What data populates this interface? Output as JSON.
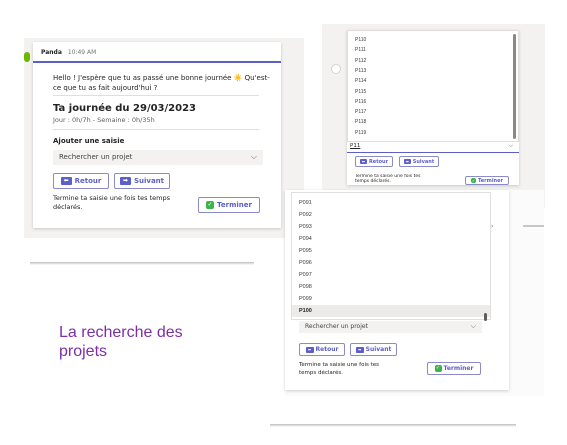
{
  "main": {
    "sender": "Panda",
    "time": "10:49 AM",
    "greeting": "Hello ! J'espère que tu as passé une bonne journée ☀️ Qu'est-ce que tu as fait aujourd'hui ?",
    "day_title": "Ta journée du 29/03/2023",
    "day_stats": "Jour : 0h/7h - Semaine : 0h/35h",
    "add_entry": "Ajouter une saisie",
    "search_placeholder": "Rechercher un projet",
    "back_label": "Retour",
    "next_label": "Suivant",
    "finish_text": "Termine ta saisie une fois tes temps déclarés.",
    "finish_label": "Terminer"
  },
  "top_right": {
    "items": [
      "P110",
      "P111",
      "P112",
      "P113",
      "P114",
      "P115",
      "P116",
      "P117",
      "P118",
      "P119"
    ],
    "typed_value": "P11",
    "back_label": "Retour",
    "next_label": "Suivant",
    "finish_text": "Termine ta saisie une fois tes temps déclarés.",
    "finish_label": "Terminer"
  },
  "bottom_right": {
    "items": [
      "P091",
      "P092",
      "P093",
      "P094",
      "P095",
      "P096",
      "P097",
      "P098",
      "P099",
      "P100"
    ],
    "search_placeholder": "Rechercher un projet",
    "back_label": "Retour",
    "next_label": "Suivant",
    "finish_text": "Termine ta saisie une fois tes temps déclarés.",
    "finish_label": "Terminer"
  },
  "caption": "La recherche des projets",
  "colors": {
    "accent": "#5b5fc7",
    "caption": "#7d2ea8",
    "success": "#3bb44a"
  }
}
